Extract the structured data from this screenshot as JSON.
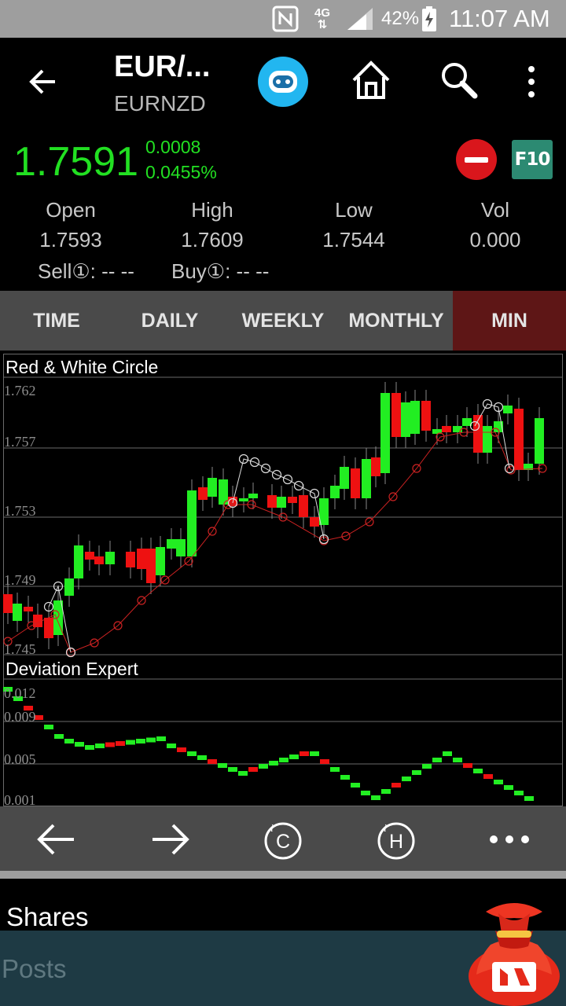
{
  "status_bar": {
    "battery": "42%",
    "time": "11:07 AM",
    "network": "4G"
  },
  "header": {
    "title": "EUR/...",
    "subtitle": "EURNZD",
    "price": "1.7591",
    "change_abs": "0.0008",
    "change_pct": "0.0455%",
    "f10_label": "F10"
  },
  "stats": [
    {
      "label": "Open",
      "value": "1.7593"
    },
    {
      "label": "High",
      "value": "1.7609"
    },
    {
      "label": "Low",
      "value": "1.7544"
    },
    {
      "label": "Vol",
      "value": "0.000"
    }
  ],
  "sell_buy": {
    "sell": "Sell①:  --  --",
    "buy": "Buy①:  --  --"
  },
  "tabs": [
    {
      "label": "TIME",
      "active": false
    },
    {
      "label": "DAILY",
      "active": false
    },
    {
      "label": "WEEKLY",
      "active": false
    },
    {
      "label": "MONTHLY",
      "active": false
    },
    {
      "label": "MIN",
      "active": true
    }
  ],
  "main_chart": {
    "label": "Red & White Circle",
    "y_ticks": [
      "1.762",
      "1.757",
      "1.753",
      "1.749",
      "1.745"
    ]
  },
  "sub_chart": {
    "label": "Deviation Expert",
    "y_ticks": [
      "0.012",
      "0.009",
      "0.005",
      "0.001"
    ]
  },
  "toolbar": {
    "c_label": "C",
    "h_label": "H"
  },
  "bottom": {
    "shares": "Shares",
    "posts": "Posts"
  },
  "colors": {
    "up": "#22ee22",
    "down": "#ee1111",
    "price": "#22e022",
    "tab_active": "#5e1616"
  }
}
